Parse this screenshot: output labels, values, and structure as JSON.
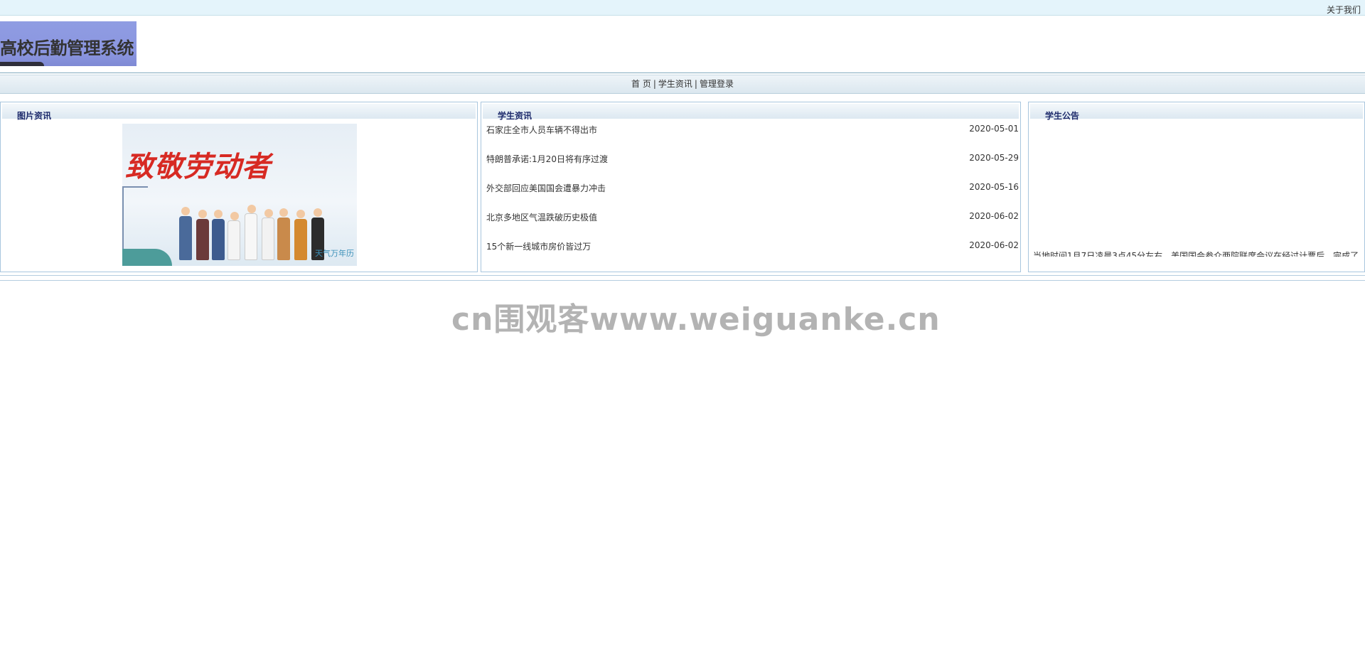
{
  "topbar": {
    "about_label": "关于我们"
  },
  "header": {
    "system_title": "高校后勤管理系统"
  },
  "nav": {
    "items": [
      {
        "label": "首 页"
      },
      {
        "label": "学生资讯"
      },
      {
        "label": "管理登录"
      }
    ],
    "separator": "|"
  },
  "picture_panel": {
    "title": "图片资讯",
    "image": {
      "headline": "致敬劳动者",
      "caption": "天气万年历"
    }
  },
  "news_panel": {
    "title": "学生资讯",
    "items": [
      {
        "title": "石家庄全市人员车辆不得出市",
        "date": "2020-05-01"
      },
      {
        "title": "特朗普承诺:1月20日将有序过渡",
        "date": "2020-05-29"
      },
      {
        "title": "外交部回应美国国会遭暴力冲击",
        "date": "2020-05-16"
      },
      {
        "title": "北京多地区气温跌破历史极值",
        "date": "2020-06-02"
      },
      {
        "title": "15个新一线城市房价皆过万",
        "date": "2020-06-02"
      }
    ]
  },
  "notice_panel": {
    "title": "学生公告",
    "text": "当地时间1月7日凌晨3点45分左右，美国国会参众两院联席会议在经过计票后，完成了"
  },
  "watermark": {
    "text": "cn围观客www.weiguanke.cn"
  }
}
